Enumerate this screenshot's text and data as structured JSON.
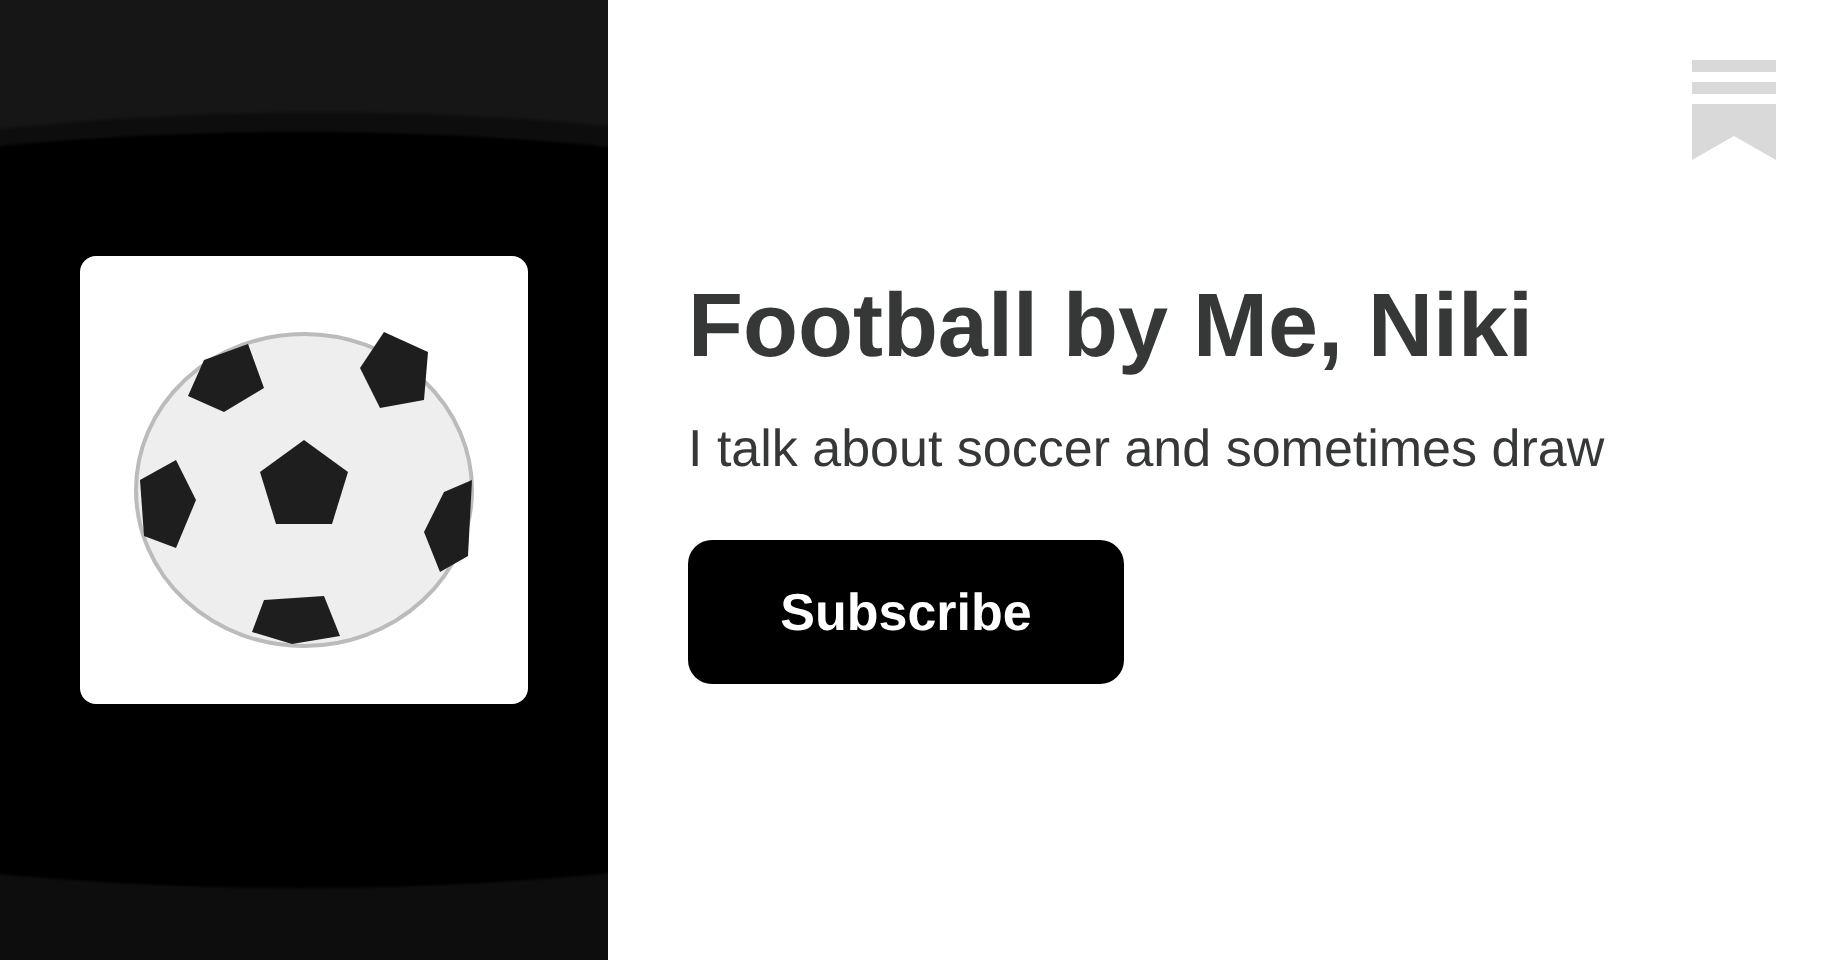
{
  "publication": {
    "title": "Football by Me, Niki",
    "description": "I talk about soccer and sometimes draw"
  },
  "subscribe_button": {
    "label": "Subscribe"
  }
}
